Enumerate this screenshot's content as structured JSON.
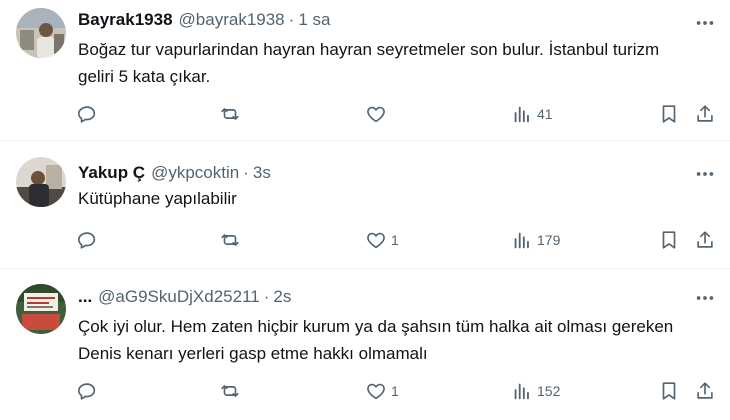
{
  "tweets": [
    {
      "name": "Bayrak1938",
      "handle": "@bayrak1938",
      "separator": "·",
      "time": "1 sa",
      "text": "Boğaz tur vapurlarindan hayran hayran seyretmeler son bulur. İstanbul turizm geliri 5 kata çıkar.",
      "replies": "",
      "retweets": "",
      "likes": "",
      "views": "41"
    },
    {
      "name": "Yakup Ç",
      "handle": "@ykpcoktin",
      "separator": "·",
      "time": "3s",
      "text": "Kütüphane yapılabilir",
      "replies": "",
      "retweets": "",
      "likes": "1",
      "views": "179"
    },
    {
      "name": "...",
      "handle": "@aG9SkuDjXd25211",
      "separator": "·",
      "time": "2s",
      "text": "Çok iyi olur. Hem zaten hiçbir kurum ya da şahsın tüm halka ait olması gereken Denis kenarı yerleri gasp etme hakkı olmamalı",
      "replies": "",
      "retweets": "",
      "likes": "1",
      "views": "152"
    }
  ],
  "icons": {
    "reply": "reply-icon",
    "retweet": "retweet-icon",
    "like": "heart-icon",
    "views": "views-icon",
    "bookmark": "bookmark-icon",
    "share": "share-icon",
    "more": "more-icon"
  },
  "colors": {
    "text": "#0f1419",
    "muted": "#536471",
    "divider": "#eff3f4"
  }
}
